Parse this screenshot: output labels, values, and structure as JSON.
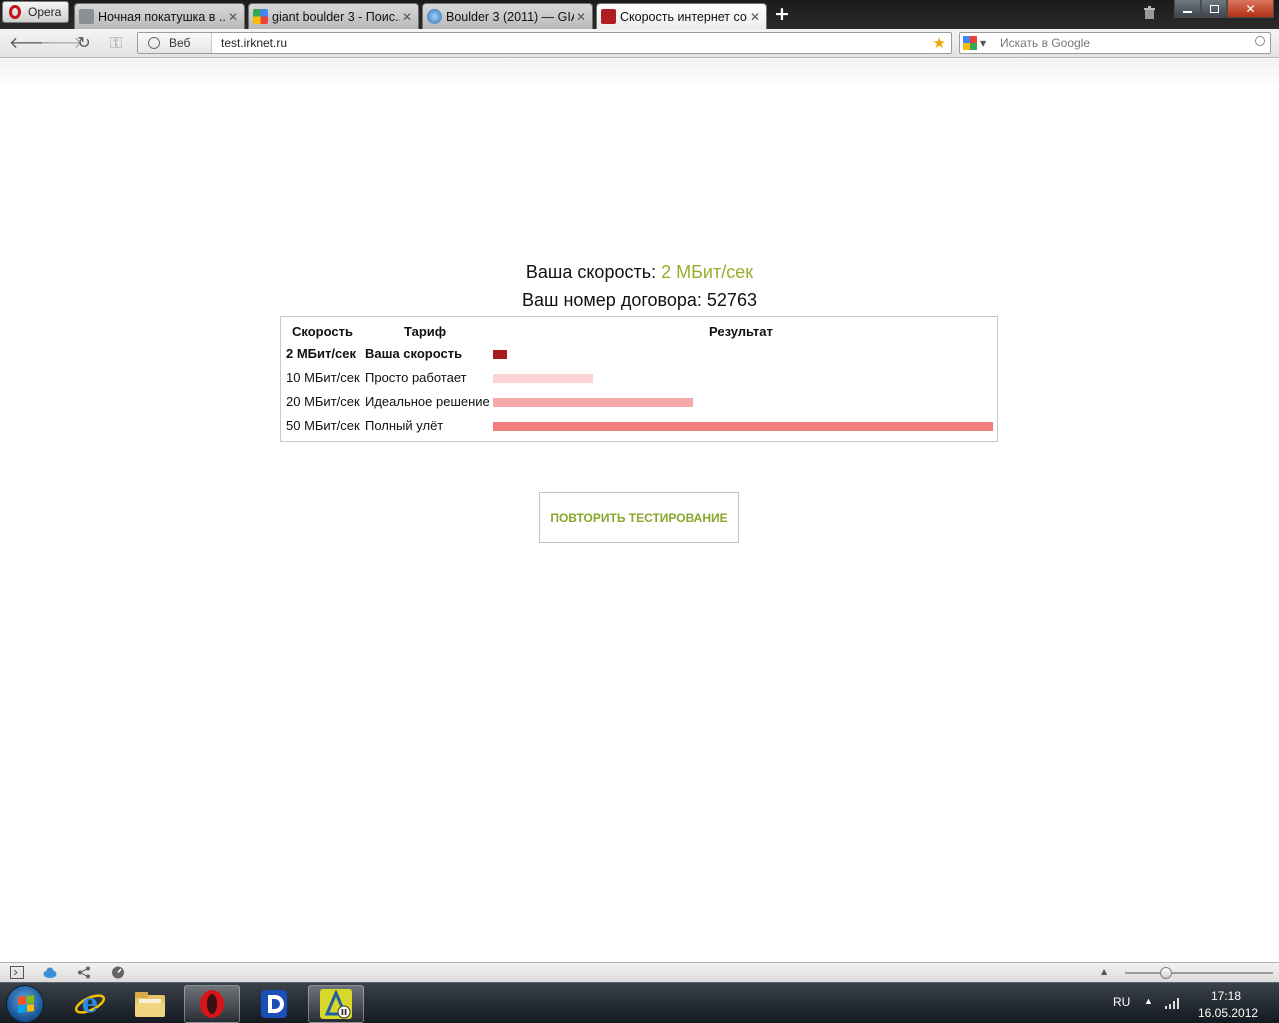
{
  "browser": {
    "menu_label": "Opera",
    "tabs": [
      {
        "title": "Ночная покатушка в ...",
        "active": false
      },
      {
        "title": "giant boulder 3 - Поис...",
        "active": false
      },
      {
        "title": "Boulder 3 (2011) — GIA...",
        "active": false
      },
      {
        "title": "Скорость интернет со...",
        "active": true
      }
    ],
    "new_tab_symbol": "+",
    "address": {
      "badge_label": "Веб",
      "url": "test.irknet.ru"
    },
    "search": {
      "placeholder": "Искать в Google"
    }
  },
  "page": {
    "speed_label": "Ваша скорость: ",
    "speed_value": "2 МБит/сек",
    "contract_label": "Ваш номер договора: 52763",
    "table": {
      "headers": {
        "speed": "Скорость",
        "tariff": "Тариф",
        "result": "Результат"
      },
      "rows": [
        {
          "speed": "2 МБит/сек",
          "tariff": "Ваша скорость",
          "bold": true,
          "bar_fraction": 0.028,
          "bar_color": "#a51a1a"
        },
        {
          "speed": "10 МБит/сек",
          "tariff": "Просто работает",
          "bold": false,
          "bar_fraction": 0.2,
          "bar_color": "#fbd3d3"
        },
        {
          "speed": "20 МБит/сек",
          "tariff": "Идеальное решение",
          "bold": false,
          "bar_fraction": 0.4,
          "bar_color": "#f5a9a9"
        },
        {
          "speed": "50 МБит/сек",
          "tariff": "Полный улёт",
          "bold": false,
          "bar_fraction": 1.0,
          "bar_color": "#f27d7d"
        }
      ]
    },
    "retest_label": "ПОВТОРИТЬ ТЕСТИРОВАНИЕ",
    "accent_color": "#9aad2b"
  },
  "taskbar": {
    "language": "RU",
    "time": "17:18",
    "date": "16.05.2012"
  }
}
